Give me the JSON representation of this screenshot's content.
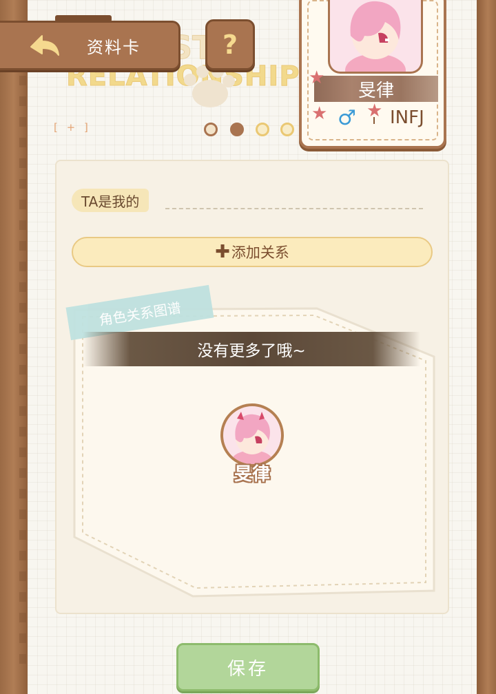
{
  "header": {
    "card_button_label": "资料卡",
    "help_button_label": "?",
    "title_line1": "ST",
    "title_line2": "RELATIONSHIPS",
    "add_tag_label": "[ + ]",
    "back_icon": "back-arrow-icon"
  },
  "character_card": {
    "name": "旻律",
    "gender_symbol": "♂",
    "mbti": "INFJ"
  },
  "panel": {
    "ta_label": "TA是我的",
    "add_relation_label": "添加关系",
    "add_relation_icon": "plus-icon",
    "map_title": "角色关系图谱",
    "empty_message": "没有更多了哦~",
    "node_name": "旻律"
  },
  "footer": {
    "save_label": "保存"
  },
  "colors": {
    "wood": "#a97450",
    "paper": "#f8f6f0",
    "accent_yellow": "#fbebbd",
    "save_green": "#b2d69a",
    "gender_blue": "#3a9ad6"
  }
}
